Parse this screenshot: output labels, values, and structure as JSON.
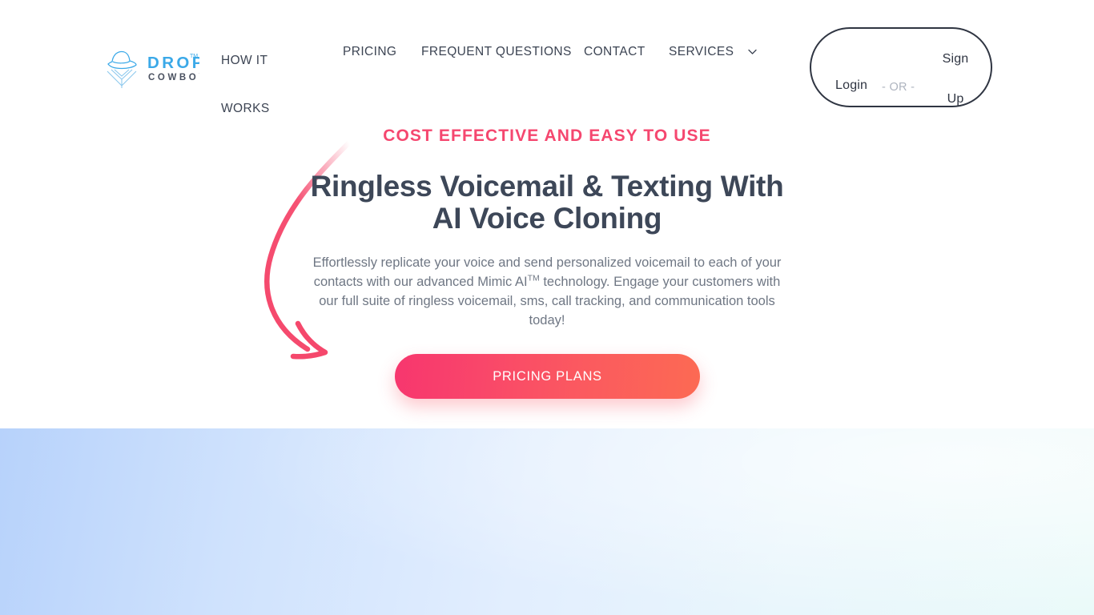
{
  "brand": {
    "logo_word_primary": "DROP",
    "logo_word_secondary": "COWBOY",
    "logo_trademark": "TM",
    "logo_icon": "cowboy-hat-icon",
    "logo_blue": "#3BA9E8",
    "logo_dark": "#4A5160"
  },
  "nav": {
    "items": [
      {
        "label": "HOW IT WORKS",
        "name": "how-it-works"
      },
      {
        "label": "PRICING",
        "name": "pricing"
      },
      {
        "label": "FREQUENT QUESTIONS",
        "name": "frequent-questions"
      },
      {
        "label": "CONTACT",
        "name": "contact"
      },
      {
        "label": "SERVICES",
        "name": "services"
      }
    ],
    "services_icon": "chevron-down-icon"
  },
  "auth": {
    "login_label": "Login",
    "divider_label": "- OR -",
    "signup_line1": "Sign",
    "signup_line2": "Up",
    "border_color": "#2F3542"
  },
  "hero": {
    "eyebrow": "COST EFFECTIVE AND EASY TO USE",
    "eyebrow_color": "#F5476F",
    "headline_line1": "Ringless Voicemail & Texting",
    "headline_line2": "With AI Voice Cloning",
    "headline_color": "#3D4758",
    "subcopy_part1": "Effortlessly replicate your voice and send personalized voicemail to each of your contacts with our advanced Mimic AI",
    "subcopy_trademark": "TM",
    "subcopy_part2": " technology. Engage your customers with our full suite of ringless voicemail, sms, call tracking, and communication tools today!",
    "cta_label": "PRICING PLANS",
    "cta_gradient_from": "#F7366E",
    "cta_gradient_to": "#FC6A53",
    "arrow_icon": "curved-down-right-arrow-icon",
    "arrow_color": "#F5486C"
  },
  "band": {
    "gradient_from": "#B7D2FB",
    "gradient_to": "#EAFAF9"
  }
}
